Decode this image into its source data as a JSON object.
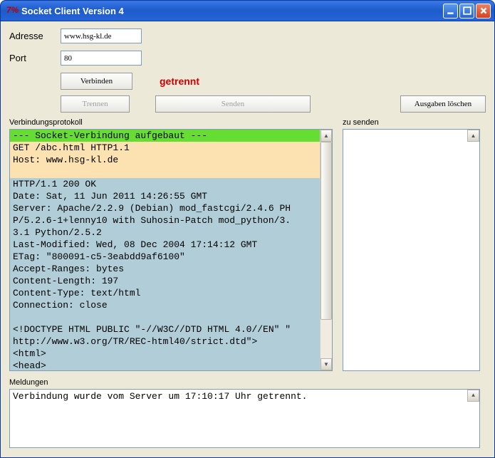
{
  "window": {
    "title": "Socket Client Version 4"
  },
  "form": {
    "address_label": "Adresse",
    "address_value": "www.hsg-kl.de",
    "port_label": "Port",
    "port_value": "80"
  },
  "buttons": {
    "connect": "Verbinden",
    "disconnect": "Trennen",
    "send": "Senden",
    "clear_output": "Ausgaben löschen"
  },
  "status": "getrennt",
  "sections": {
    "protocol": "Verbindungsprotokoll",
    "to_send": "zu senden",
    "messages": "Meldungen"
  },
  "protocol": {
    "green_line": "--- Socket-Verbindung aufgebaut ---",
    "request": "GET /abc.html HTTP1.1\nHost: www.hsg-kl.de\n ",
    "response": "HTTP/1.1 200 OK\nDate: Sat, 11 Jun 2011 14:26:55 GMT\nServer: Apache/2.2.9 (Debian) mod_fastcgi/2.4.6 PH\nP/5.2.6-1+lenny10 with Suhosin-Patch mod_python/3.\n3.1 Python/2.5.2\nLast-Modified: Wed, 08 Dec 2004 17:14:12 GMT\nETag: \"800091-c5-3eabdd9af6100\"\nAccept-Ranges: bytes\nContent-Length: 197\nContent-Type: text/html\nConnection: close\n \n<!DOCTYPE HTML PUBLIC \"-//W3C//DTD HTML 4.0//EN\" \"\nhttp://www.w3.org/TR/REC-html40/strict.dtd\">\n<html>\n<head>"
  },
  "messages_text": "Verbindung wurde vom Server um 17:10:17 Uhr getrennt."
}
